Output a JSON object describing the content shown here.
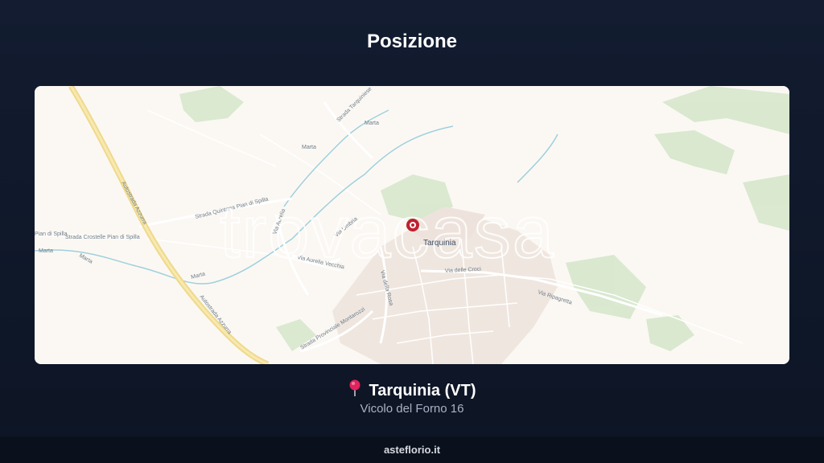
{
  "header": {
    "title": "Posizione"
  },
  "map": {
    "town_label": "Tarquinia",
    "watermark": "trovacasa",
    "road_labels": {
      "autostrada_north": "Autostrada Azzurra",
      "autostrada_south": "Autostrada Azzurra",
      "strada_tarquiniese": "Strada Tarquiniese",
      "strada_ponte": "Strada Quintana Pian di Spilla",
      "strada_crostelle": "Strada Crostelle Pian di Spilla",
      "pian_di_spilla": "Pian di Spilla",
      "via_aurelia_west": "Via Aurelia",
      "via_aurelia_vecchia": "Via Aurelia Vecchia",
      "via_umbria": "Via Umbria",
      "via_della_rosa": "Via della Rosa",
      "via_delle_croci": "Via delle Croci",
      "via_ripagretta": "Via Ripagretta",
      "strada_provinciale": "Strada Provinciale Montarozzi",
      "marta_1": "Marta",
      "marta_2": "Marta",
      "marta_3": "Marta",
      "marta_4": "Marta",
      "marta_5": "Marta"
    },
    "marker_icon": "map-pin-icon",
    "colors": {
      "marker": "#c0202f",
      "road_major": "#f1dc8a",
      "water": "#8cc7d6",
      "green": "#cfe3c3"
    }
  },
  "location": {
    "pin_icon": "pushpin-icon",
    "city": "Tarquinia (VT)",
    "address": "Vicolo del Forno 16"
  },
  "footer": {
    "brand": "asteflorio.it"
  }
}
